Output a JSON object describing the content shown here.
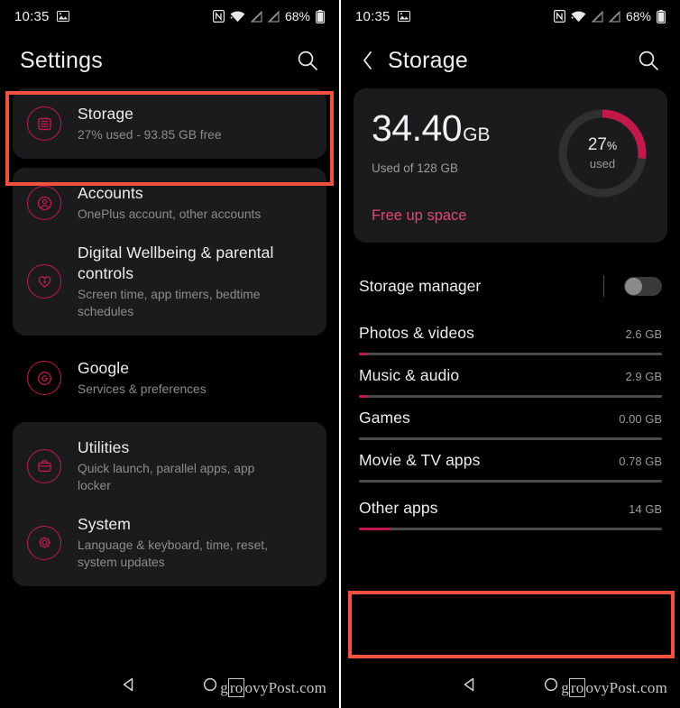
{
  "statusbar": {
    "time": "10:35",
    "left_icons": [
      "photo-icon"
    ],
    "right_icons": [
      "nfc-icon",
      "wifi-icon",
      "signal-off-icon",
      "signal-off-icon"
    ],
    "battery_percent": "68%"
  },
  "left_panel": {
    "appbar": {
      "title": "Settings",
      "search_icon": "search-icon"
    },
    "groups": [
      {
        "style": "card",
        "items": [
          {
            "icon": "storage-icon",
            "title": "Storage",
            "subtitle": "27% used - 93.85 GB free"
          }
        ]
      },
      {
        "style": "card",
        "items": [
          {
            "icon": "account-icon",
            "title": "Accounts",
            "subtitle": "OnePlus account, other accounts"
          },
          {
            "icon": "wellbeing-heart-icon",
            "title": "Digital Wellbeing & parental controls",
            "subtitle": "Screen time, app timers, bedtime schedules"
          }
        ]
      },
      {
        "style": "plain",
        "items": [
          {
            "icon": "google-icon",
            "title": "Google",
            "subtitle": "Services & preferences"
          }
        ]
      },
      {
        "style": "card",
        "items": [
          {
            "icon": "utilities-briefcase-icon",
            "title": "Utilities",
            "subtitle": "Quick launch, parallel apps, app locker"
          },
          {
            "icon": "system-gear-icon",
            "title": "System",
            "subtitle": "Language & keyboard, time, reset, system updates"
          }
        ]
      }
    ],
    "highlight": {
      "target": "Storage",
      "color": "#f4503f"
    },
    "navbar": {
      "back_icon": "nav-back-triangle-icon",
      "home_icon": "nav-home-circle-icon"
    },
    "watermark": {
      "pre": "g",
      "boxed": "ro",
      "post": "ovyPost.com"
    }
  },
  "right_panel": {
    "appbar": {
      "back_icon": "back-chevron-icon",
      "title": "Storage",
      "search_icon": "search-icon"
    },
    "summary": {
      "used_value": "34.40",
      "used_unit": "GB",
      "used_of": "Used of 128 GB",
      "free_up_link": "Free up space",
      "donut_percent": "27",
      "donut_percent_symbol": "%",
      "donut_caption": "used",
      "donut_fill_fraction": 0.27,
      "donut_fill_color": "#c2184b",
      "donut_track_color": "#303032"
    },
    "storage_manager": {
      "label": "Storage manager",
      "enabled": false
    },
    "categories": [
      {
        "name": "Photos & videos",
        "size": "2.6 GB",
        "fill_percent": 2.6
      },
      {
        "name": "Music & audio",
        "size": "2.9 GB",
        "fill_percent": 2.9
      },
      {
        "name": "Games",
        "size": "0.00 GB",
        "fill_percent": 0
      },
      {
        "name": "Movie & TV apps",
        "size": "0.78 GB",
        "fill_percent": 0
      },
      {
        "name": "Other apps",
        "size": "14 GB",
        "fill_percent": 10.5
      }
    ],
    "highlight": {
      "target": "Other apps",
      "color": "#f4503f"
    },
    "navbar": {
      "back_icon": "nav-back-triangle-icon",
      "home_icon": "nav-home-circle-icon"
    },
    "watermark": {
      "pre": "g",
      "boxed": "ro",
      "post": "ovyPost.com"
    }
  },
  "accent_color": "#c2184b",
  "card_color": "#1b1b1d",
  "background_color": "#000000"
}
